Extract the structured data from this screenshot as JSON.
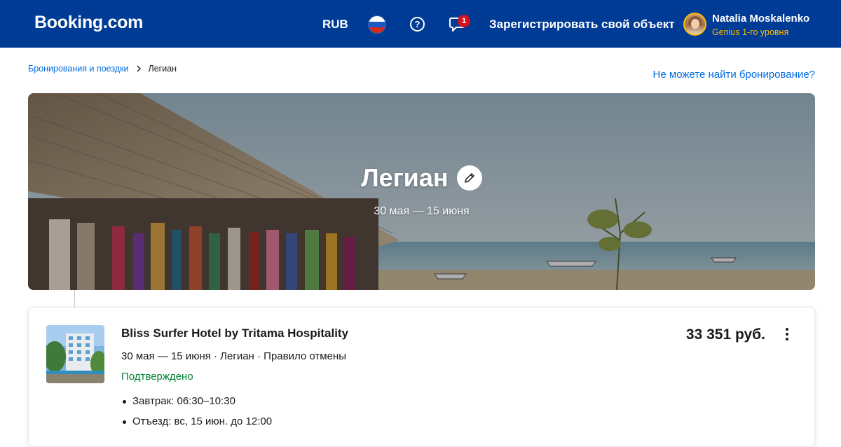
{
  "header": {
    "logo": "Booking.com",
    "currency": "RUB",
    "language_flag": "russia-flag",
    "help_icon": "question-circle-icon",
    "messages_icon": "chat-bubble-icon",
    "messages_badge": "1",
    "list_property": "Зарегистрировать свой объект",
    "user": {
      "name": "Natalia Moskalenko",
      "level": "Genius 1-го уровня"
    },
    "colors": {
      "background": "#003b95",
      "accent": "#febb02",
      "badge": "#d4111e"
    }
  },
  "breadcrumbs": {
    "parent": "Бронирования и поездки",
    "current": "Легиан"
  },
  "cant_find_link": "Не можете найти бронирование?",
  "hero": {
    "title": "Легиан",
    "dates": "30 мая — 15 июня",
    "edit_icon": "pencil-icon"
  },
  "booking": {
    "hotel_name": "Bliss Surfer Hotel by Tritama Hospitality",
    "meta": "30 мая — 15 июня · Легиан · Правило отмены",
    "status": "Подтверждено",
    "details": [
      "Завтрак: 06:30–10:30",
      "Отъезд: вс, 15 июн. до 12:00"
    ],
    "price": "33 351 руб.",
    "more_icon": "kebab-menu-icon",
    "colors": {
      "status": "#008234",
      "link": "#006ce4"
    }
  }
}
